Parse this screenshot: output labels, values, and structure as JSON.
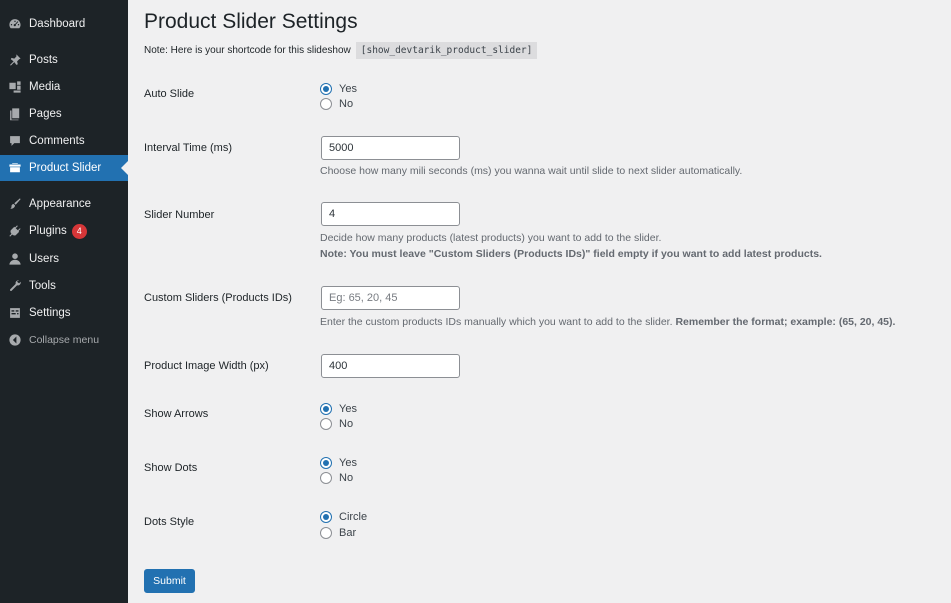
{
  "sidebar": {
    "items": [
      {
        "label": "Dashboard",
        "icon": "dashboard-icon"
      },
      {
        "label": "Posts",
        "icon": "pin-icon"
      },
      {
        "label": "Media",
        "icon": "media-icon"
      },
      {
        "label": "Pages",
        "icon": "pages-icon"
      },
      {
        "label": "Comments",
        "icon": "comment-icon"
      },
      {
        "label": "Product Slider",
        "icon": "product-slider-icon",
        "active": true
      },
      {
        "label": "Appearance",
        "icon": "brush-icon"
      },
      {
        "label": "Plugins",
        "icon": "plugin-icon",
        "badge": "4"
      },
      {
        "label": "Users",
        "icon": "user-icon"
      },
      {
        "label": "Tools",
        "icon": "wrench-icon"
      },
      {
        "label": "Settings",
        "icon": "settings-icon"
      }
    ],
    "collapse_label": "Collapse menu",
    "active_color": "#2271b1",
    "badge_color": "#d63638"
  },
  "page": {
    "title": "Product Slider Settings",
    "note": "Note: Here is your shortcode for this slideshow",
    "shortcode": "[show_devtarik_product_slider]"
  },
  "form": {
    "auto_slide": {
      "label": "Auto Slide",
      "options": [
        "Yes",
        "No"
      ],
      "selected": "Yes"
    },
    "interval": {
      "label": "Interval Time (ms)",
      "value": "5000",
      "description": "Choose how many mili seconds (ms) you wanna wait until slide to next slider automatically."
    },
    "slider_number": {
      "label": "Slider Number",
      "value": "4",
      "description": "Decide how many products (latest products) you want to add to the slider.",
      "note": "Note: You must leave \"Custom Sliders (Products IDs)\" field empty if you want to add latest products."
    },
    "custom_sliders": {
      "label": "Custom Sliders (Products IDs)",
      "value": "",
      "placeholder": "Eg: 65, 20, 45",
      "description": "Enter the custom products IDs manually which you want to add to the slider.",
      "description_bold": "Remember the format; example: (65, 20, 45)."
    },
    "image_width": {
      "label": "Product Image Width (px)",
      "value": "400"
    },
    "show_arrows": {
      "label": "Show Arrows",
      "options": [
        "Yes",
        "No"
      ],
      "selected": "Yes"
    },
    "show_dots": {
      "label": "Show Dots",
      "options": [
        "Yes",
        "No"
      ],
      "selected": "Yes"
    },
    "dots_style": {
      "label": "Dots Style",
      "options": [
        "Circle",
        "Bar"
      ],
      "selected": "Circle"
    },
    "submit_label": "Submit"
  }
}
